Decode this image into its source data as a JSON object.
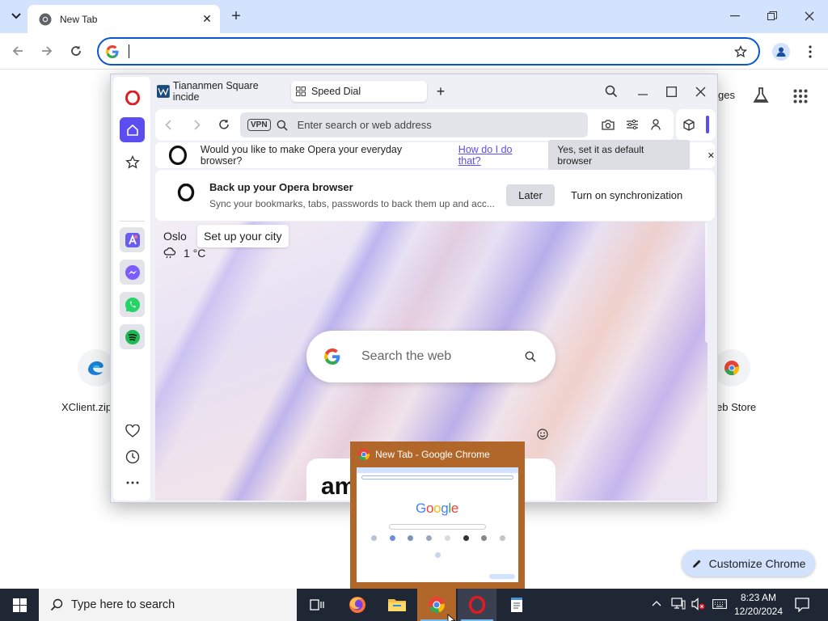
{
  "chrome": {
    "tab_title": "New Tab",
    "shortcuts": [
      {
        "label": "XClient.zip",
        "icon": "edge-icon"
      },
      {
        "label": "eb Store",
        "icon": "chrome-webstore-icon"
      }
    ],
    "right_partial_label": "ges",
    "customize_label": "Customize Chrome"
  },
  "opera": {
    "tabs": [
      {
        "label": "Tiananmen Square incide"
      },
      {
        "label": "Speed Dial"
      }
    ],
    "address_placeholder": "Enter search or web address",
    "vpn_label": "VPN",
    "default_prompt": "Would you like to make Opera your everyday browser?",
    "default_link": "How do I do that?",
    "default_button": "Yes, set it as default browser",
    "sync_title": "Back up your Opera browser",
    "sync_desc": "Sync your bookmarks, tabs, passwords to back them up and acc...",
    "later_label": "Later",
    "sync_button": "Turn on synchronization",
    "weather_city": "Oslo",
    "weather_temp": "1 °C",
    "city_tooltip": "Set up your city",
    "search_placeholder": "Search the web",
    "card_text": "am"
  },
  "preview": {
    "title": "New Tab - Google Chrome",
    "thumb_logo": "Google"
  },
  "taskbar": {
    "search_placeholder": "Type here to search",
    "time": "8:23 AM",
    "date": "12/20/2024"
  },
  "colors": {
    "chrome_tabstrip": "#d3e3fd",
    "chrome_focus": "#0b57d0",
    "opera_red": "#e01b24",
    "opera_accent": "#5b4df0",
    "preview_bg": "#b2672a",
    "taskbar_bg": "#1f2735"
  }
}
